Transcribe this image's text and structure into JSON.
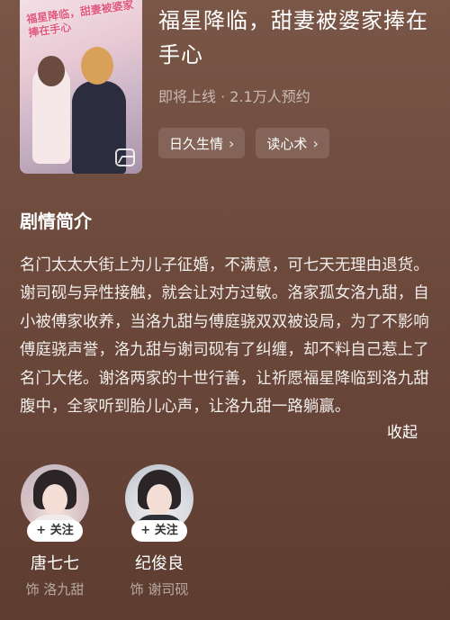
{
  "drama": {
    "cover_title": "福星降临，甜妻被婆家捧在手心",
    "title": "福星降临，甜妻被婆家捧在手心",
    "meta": "即将上线 · 2.1万人预约",
    "tags": [
      {
        "label": "日久生情"
      },
      {
        "label": "读心术"
      }
    ]
  },
  "synopsis": {
    "heading": "剧情简介",
    "text": "名门太太大街上为儿子征婚，不满意，可七天无理由退货。谢司砚与异性接触，就会让对方过敏。洛家孤女洛九甜，自小被傅家收养，当洛九甜与傅庭骁双双被设局，为了不影响傅庭骁声誉，洛九甜与谢司砚有了纠缠，却不料自己惹上了名门大佬。谢洛两家的十世行善，让祈愿福星降临到洛九甜腹中，全家听到胎儿心声，让洛九甜一路躺赢。",
    "collapse_label": "收起"
  },
  "cast": [
    {
      "name": "唐七七",
      "role": "饰 洛九甜",
      "follow_label": "+ 关注"
    },
    {
      "name": "纪俊良",
      "role": "饰 谢司砚",
      "follow_label": "+ 关注"
    }
  ],
  "icons": {
    "gallery": "image-gallery-icon",
    "chevron": "chevron-right-icon"
  }
}
